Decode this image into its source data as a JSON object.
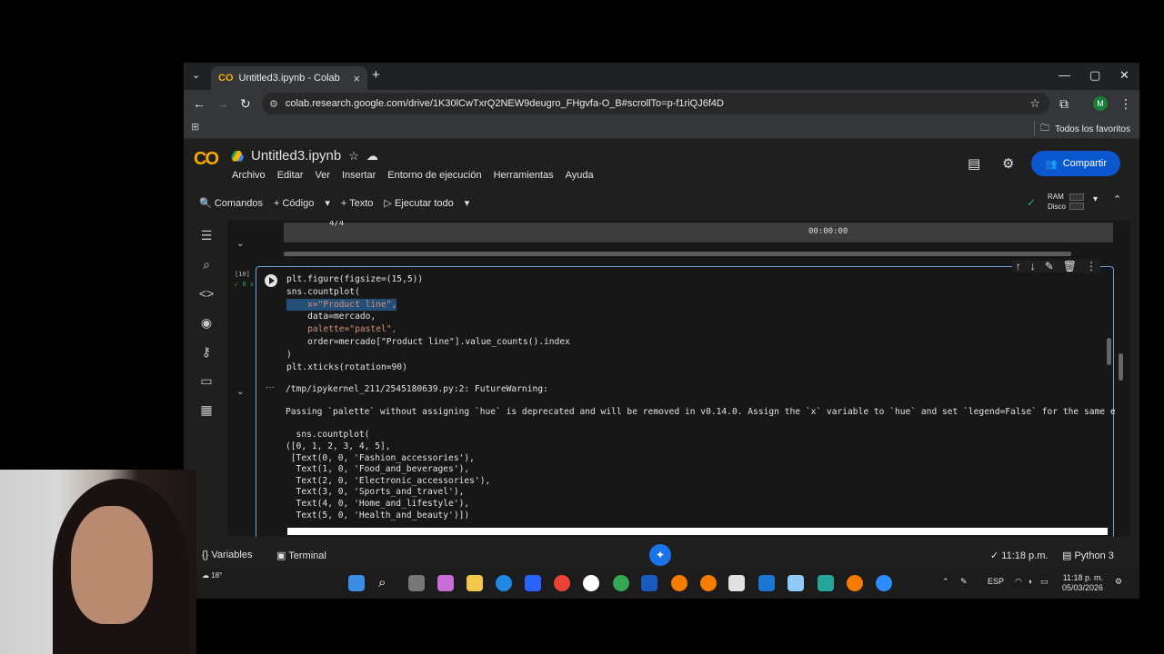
{
  "browser": {
    "tab_title": "Untitled3.ipynb - Colab",
    "tab_brand": "CO",
    "url": "colab.research.google.com/drive/1K30lCwTxrQ2NEW9deugro_FHgvfa-O_B#scrollTo=p-f1riQJ6f4D",
    "bookmarks_label": "Todos los favoritos",
    "avatar_letter": "M"
  },
  "colab": {
    "logo": "CO",
    "notebook_title": "Untitled3.ipynb",
    "menu": [
      "Archivo",
      "Editar",
      "Ver",
      "Insertar",
      "Entorno de ejecución",
      "Herramientas",
      "Ayuda"
    ],
    "share_label": "Compartir",
    "toolbar": {
      "commands": "Comandos",
      "code": "Código",
      "text": "Texto",
      "run_all": "Ejecutar todo"
    },
    "ram_label": "RAM",
    "disk_label": "Disco"
  },
  "prev_output": {
    "progress": "4/4",
    "time": "00:00:00"
  },
  "cell": {
    "exec_count": "[10]",
    "exec_time": "0 s",
    "code_lines": [
      "plt.figure(figsize=(15,5))",
      "sns.countplot(",
      "    x=\"Product line\",",
      "    data=mercado,",
      "    palette=\"pastel\",",
      "    order=mercado[\"Product line\"].value_counts().index",
      ")",
      "plt.xticks(rotation=90)"
    ],
    "output_lines": [
      "/tmp/ipykernel_211/2545180639.py:2: FutureWarning:",
      "",
      "Passing `palette` without assigning `hue` is deprecated and will be removed in v0.14.0. Assign the `x` variable to `hue` and set `legend=False` for the same effe",
      "",
      "  sns.countplot(",
      "([0, 1, 2, 3, 4, 5],",
      " [Text(0, 0, 'Fashion_accessories'),",
      "  Text(1, 0, 'Food_and_beverages'),",
      "  Text(2, 0, 'Electronic_accessories'),",
      "  Text(3, 0, 'Sports_and_travel'),",
      "  Text(4, 0, 'Home_and_lifestyle'),",
      "  Text(5, 0, 'Health_and_beauty')])"
    ]
  },
  "statusbar": {
    "variables": "Variables",
    "terminal": "Terminal",
    "time": "11:18 p.m.",
    "runtime": "Python 3"
  },
  "taskbar": {
    "weather": "18°",
    "lang": "ESP",
    "clock_time": "11:18 p. m.",
    "clock_date": "05/03/2026"
  },
  "colors": {
    "accent": "#0b57d0",
    "colab_orange": "#f9ab00",
    "string_color": "#ce9178"
  }
}
